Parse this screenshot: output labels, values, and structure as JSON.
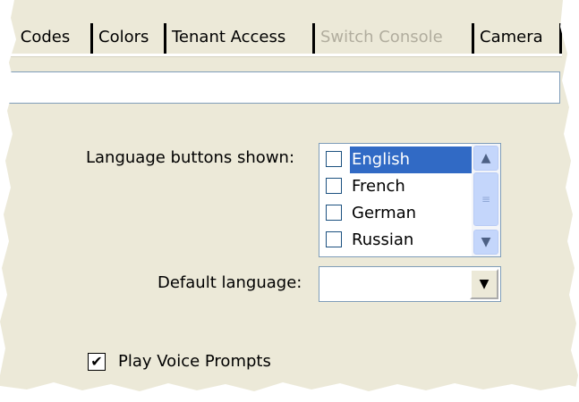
{
  "tabs": [
    {
      "label": "e Codes",
      "disabled": false
    },
    {
      "label": "Colors",
      "disabled": false
    },
    {
      "label": "Tenant Access",
      "disabled": false
    },
    {
      "label": "Switch Console",
      "disabled": true
    },
    {
      "label": "Camera",
      "disabled": false
    }
  ],
  "top_field": {
    "value": ""
  },
  "language_buttons": {
    "label": "Language buttons shown:",
    "items": [
      {
        "label": "English",
        "checked": false,
        "selected": true
      },
      {
        "label": "French",
        "checked": false,
        "selected": false
      },
      {
        "label": "German",
        "checked": false,
        "selected": false
      },
      {
        "label": "Russian",
        "checked": false,
        "selected": false
      }
    ],
    "scroll_up_icon": "▲",
    "scroll_down_icon": "▼",
    "scroll_grip_icon": "≡"
  },
  "default_language": {
    "label": "Default language:",
    "value": "",
    "dropdown_icon": "▼"
  },
  "voice_prompts": {
    "label": "Play Voice Prompts",
    "checked": true,
    "check_glyph": "✔"
  },
  "colors": {
    "panel_bg": "#ece9d8",
    "selection": "#316ac5",
    "border": "#7f9db9"
  }
}
